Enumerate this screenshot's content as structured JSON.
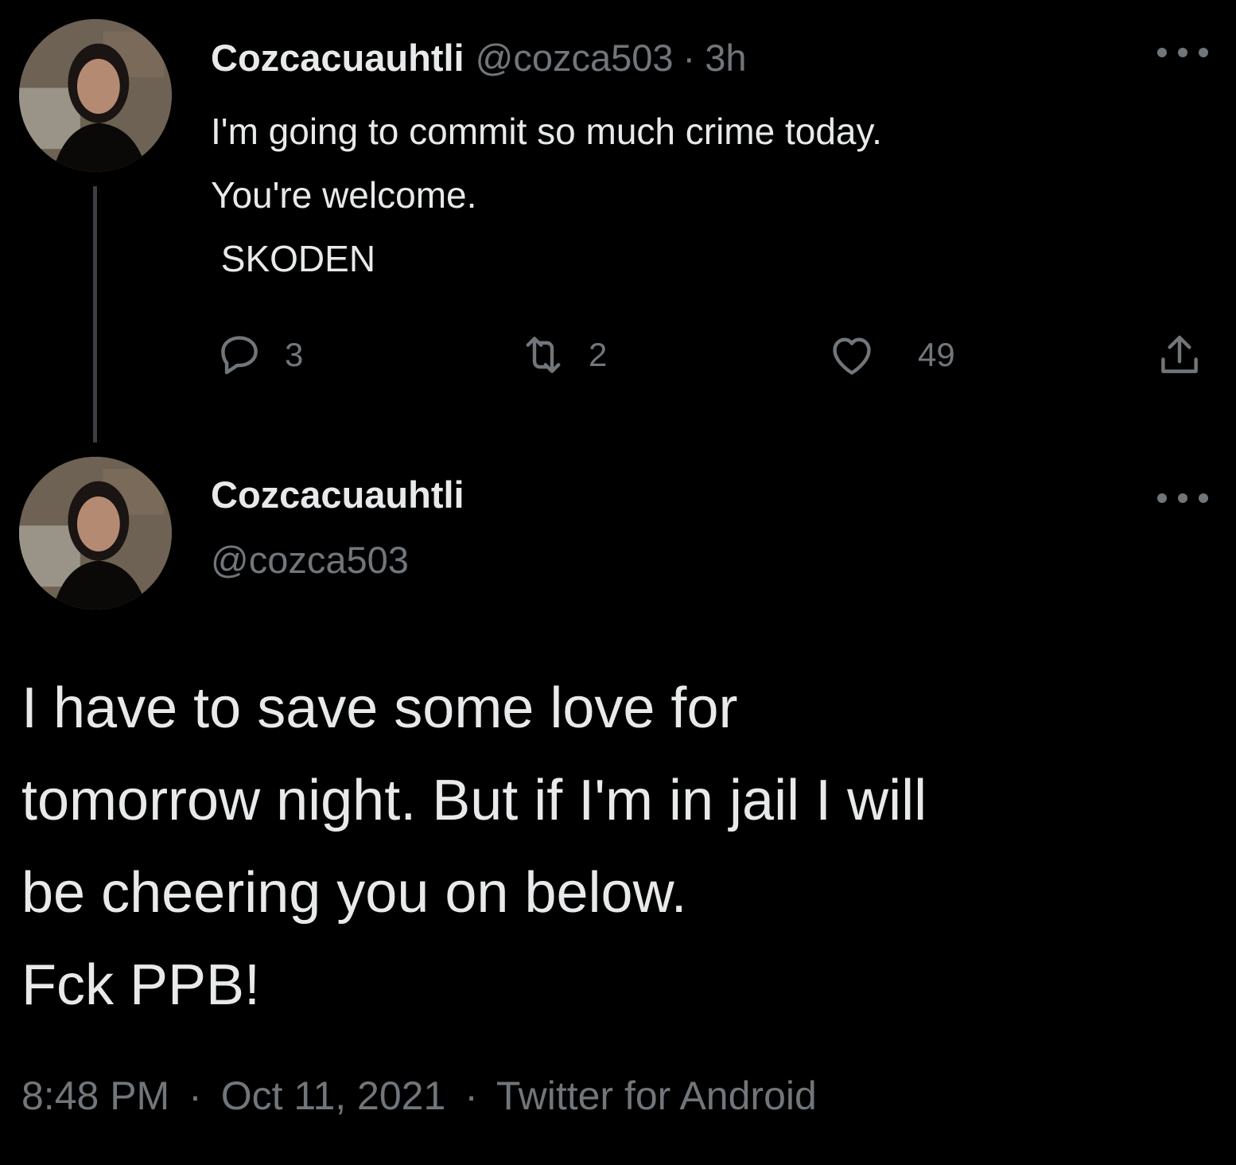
{
  "tweet1": {
    "author_name": "Cozcacuauhtli",
    "handle": "@cozca503",
    "separator": "·",
    "time": "3h",
    "text_lines": [
      "I'm going to commit so much crime today.",
      "You're welcome.",
      " SKODEN"
    ],
    "actions": {
      "reply_count": "3",
      "retweet_count": "2",
      "like_count": "49"
    }
  },
  "tweet2": {
    "author_name": "Cozcacuauhtli",
    "handle": "@cozca503",
    "text_lines": [
      "I have to save some love for",
      "tomorrow night. But if I'm in jail I will",
      "be cheering you on below.",
      "Fck PPB!"
    ],
    "timestamp": "8:48 PM",
    "date": "Oct 11, 2021",
    "source": "Twitter for Android",
    "separator": "·"
  },
  "icons": {
    "reply": "reply-icon",
    "retweet": "retweet-icon",
    "like": "heart-icon",
    "share": "share-icon",
    "more": "more-options-icon"
  },
  "colors": {
    "background": "#000000",
    "text_primary": "#e7e9ea",
    "text_secondary": "#71767b",
    "thread_line": "#3b3f43"
  }
}
